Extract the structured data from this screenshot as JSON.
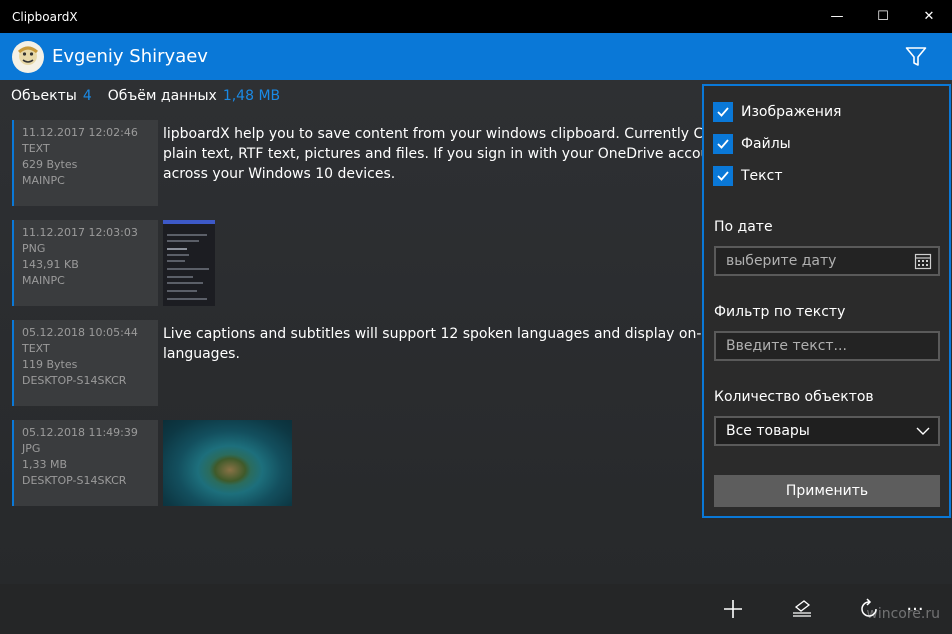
{
  "window": {
    "title": "ClipboardX",
    "minimize": "—",
    "maximize": "☐",
    "close": "✕"
  },
  "header": {
    "user_name": "Evgeniy Shiryaev"
  },
  "stats": {
    "objects_label": "Объекты",
    "objects_count": "4",
    "data_label": "Объём данных",
    "data_size": "1,48 MB"
  },
  "items": [
    {
      "date": "11.12.2017 12:02:46",
      "type": "TEXT",
      "size": "629 Bytes",
      "device": "MAINPC",
      "lines": [
        "lipboardX help you to save content from your windows clipboard. Currently Clipbo",
        "plain text, RTF text, pictures and files. If you sign in with your OneDrive account, yo",
        "across your Windows 10 devices."
      ]
    },
    {
      "date": "11.12.2017 12:03:03",
      "type": "PNG",
      "size": "143,91 KB",
      "device": "MAINPC"
    },
    {
      "date": "05.12.2018 10:05:44",
      "type": "TEXT",
      "size": "119 Bytes",
      "device": "DESKTOP-S14SKCR",
      "lines": [
        "Live captions and subtitles will support 12 spoken languages and display on-scree",
        "languages."
      ]
    },
    {
      "date": "05.12.2018 11:49:39",
      "type": "JPG",
      "size": "1,33 MB",
      "device": "DESKTOP-S14SKCR"
    }
  ],
  "filter_panel": {
    "checkboxes": [
      {
        "label": "Изображения",
        "checked": true
      },
      {
        "label": "Файлы",
        "checked": true
      },
      {
        "label": "Текст",
        "checked": true
      }
    ],
    "date_label": "По дате",
    "date_placeholder": "выберите дату",
    "text_filter_label": "Фильтр по тексту",
    "text_filter_placeholder": "Введите текст...",
    "count_label": "Количество объектов",
    "count_selected": "Все товары",
    "apply_label": "Применить"
  },
  "bottom_bar": {
    "more": "···",
    "watermark": "wincore.ru"
  },
  "colors": {
    "accent": "#0a78d7",
    "titlebar": "#000000",
    "background": "#2b2d2f"
  }
}
